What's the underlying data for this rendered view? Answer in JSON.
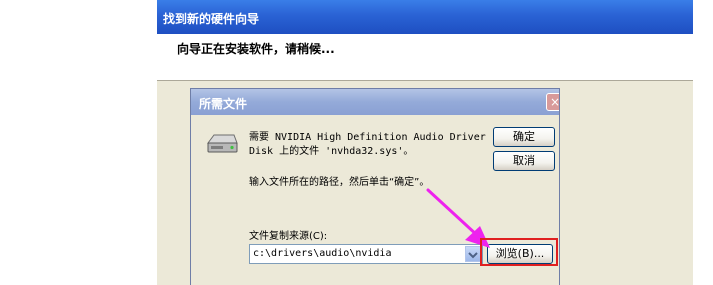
{
  "wizard": {
    "title": "找到新的硬件向导",
    "header_text": "向导正在安装软件，请稍候..."
  },
  "dialog": {
    "title": "所需文件",
    "close_glyph": "×",
    "message_line1": "需要 NVIDIA High Definition Audio Driver",
    "message_line2": "Disk 上的文件 'nvhda32.sys'。",
    "instruction": "输入文件所在的路径，然后单击“确定”。",
    "ok_label": "确定",
    "cancel_label": "取消",
    "path_label": "文件复制来源(C):",
    "path_value": "c:\\drivers\\audio\\nvidia",
    "browse_label": "浏览(B)..."
  },
  "colors": {
    "highlight_box": "#e02020",
    "arrow": "#ee22ee"
  },
  "icons": {
    "drive": "drive-icon",
    "dropdown": "chevron-down-icon",
    "annotation": "arrow-pointer"
  }
}
